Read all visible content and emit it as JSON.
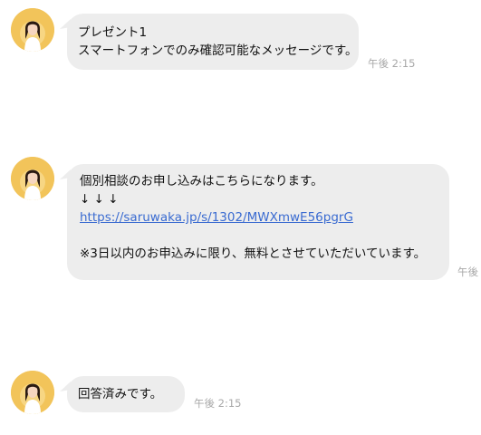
{
  "messages": [
    {
      "lines": [
        "プレゼント1",
        "スマートフォンでのみ確認可能なメッセージです。"
      ],
      "time": "午後 2:15"
    },
    {
      "lines": [
        "個別相談のお申し込みはこちらになります。",
        "↓ ↓ ↓"
      ],
      "link": "https://saruwaka.jp/s/1302/MWXmwE56pgrG",
      "note": "※3日以内のお申込みに限り、無料とさせていただいています。",
      "time": "午後"
    },
    {
      "lines": [
        "回答済みです。"
      ],
      "time": "午後 2:15"
    }
  ],
  "colors": {
    "bubble": "#ededed",
    "avatar_bg": "#f2c45a",
    "link": "#3a6bd1",
    "timestamp": "#a8a8a8"
  },
  "icons": [
    "sender-avatar"
  ]
}
